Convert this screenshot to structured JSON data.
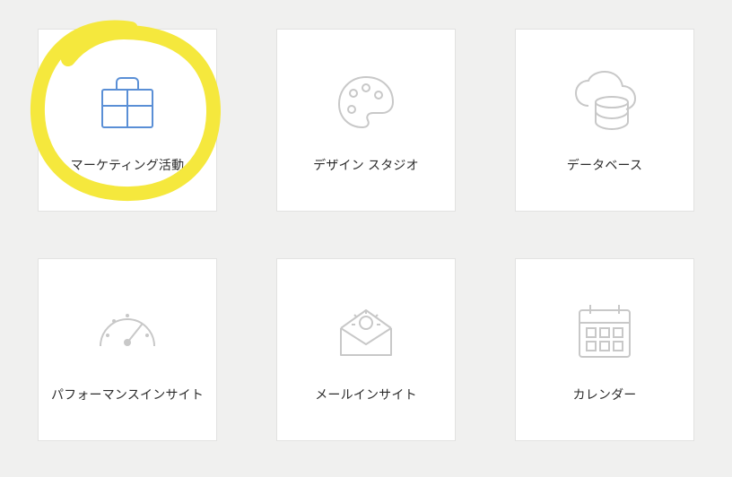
{
  "tiles": [
    {
      "label": "マーケティング活動",
      "icon": "briefcase-icon",
      "highlighted": true
    },
    {
      "label": "デザイン スタジオ",
      "icon": "palette-icon",
      "highlighted": false
    },
    {
      "label": "データベース",
      "icon": "cloud-database-icon",
      "highlighted": false
    },
    {
      "label": "パフォーマンスインサイト",
      "icon": "gauge-icon",
      "highlighted": false
    },
    {
      "label": "メールインサイト",
      "icon": "mail-idea-icon",
      "highlighted": false
    },
    {
      "label": "カレンダー",
      "icon": "calendar-icon",
      "highlighted": false
    }
  ],
  "icon_colors": {
    "highlight_stroke": "#5a8fd6",
    "default_stroke": "#c8c8c8",
    "annotation_stroke": "#f5e83d"
  }
}
